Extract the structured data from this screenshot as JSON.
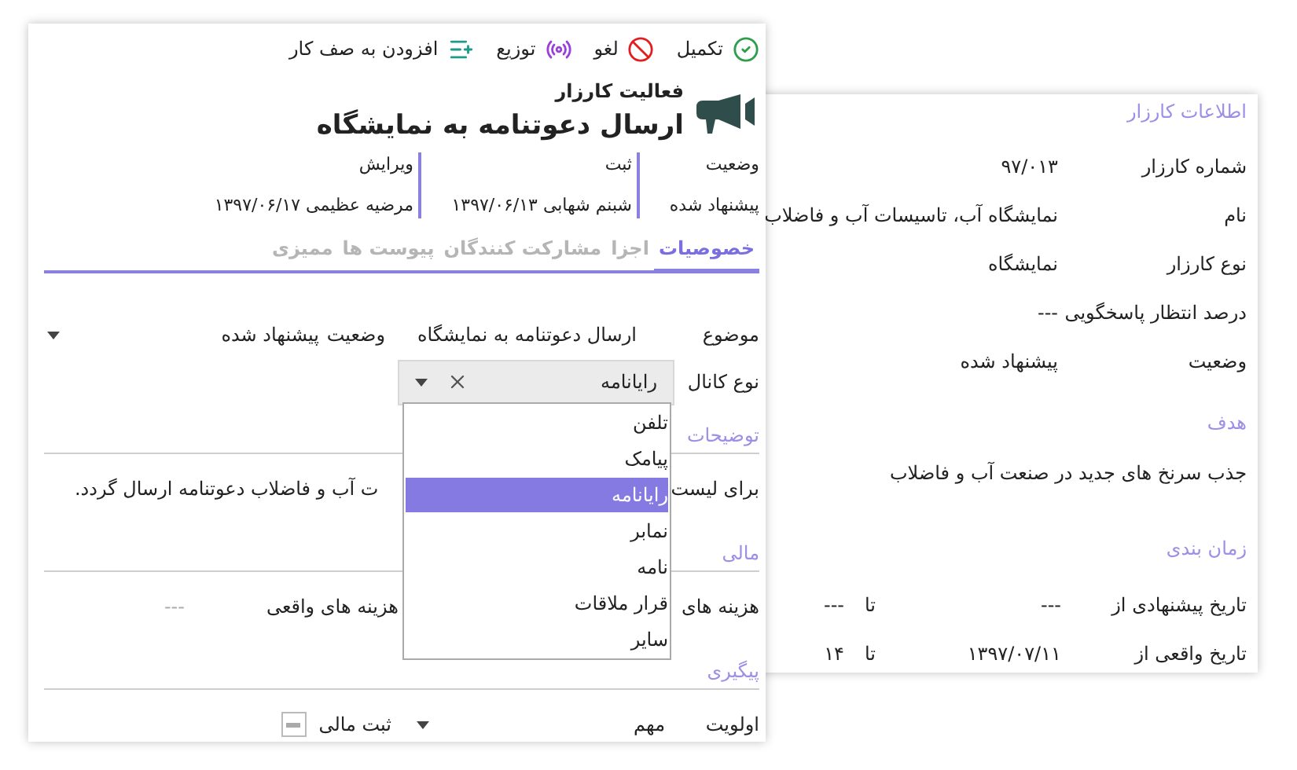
{
  "toolbar": [
    {
      "kind": "complete",
      "label": "تکمیل"
    },
    {
      "kind": "cancel",
      "label": "لغو"
    },
    {
      "kind": "distribute",
      "label": "توزیع"
    },
    {
      "kind": "queue",
      "label": "افزودن به صف کار"
    }
  ],
  "header": {
    "subtitle": "فعالیت کارزار",
    "title": "ارسال دعوتنامه به نمایشگاه"
  },
  "info": [
    {
      "label": "وضعیت",
      "value": "پیشنهاد شده"
    },
    {
      "label": "ثبت",
      "value": "شبنم شهابی ۱۳۹۷/۰۶/۱۳"
    },
    {
      "label": "ویرایش",
      "value": "مرضیه عظیمی ۱۳۹۷/۰۶/۱۷"
    }
  ],
  "tabs": [
    {
      "label": "خصوصیات",
      "selected": true
    },
    {
      "label": "اجزا",
      "selected": false
    },
    {
      "label": "مشارکت کنندگان",
      "selected": false
    },
    {
      "label": "پیوست ها",
      "selected": false
    },
    {
      "label": "ممیزی",
      "selected": false
    }
  ],
  "details": {
    "subject_label": "موضوع",
    "subject": "ارسال دعوتنامه به نمایشگاه",
    "status_label": "وضعیت",
    "status": "پیشنهاد شده",
    "channel_label": "نوع کانال",
    "channel": "رایانامه"
  },
  "channel_menu": [
    {
      "label": "تلفن",
      "selected": false
    },
    {
      "label": "پیامک",
      "selected": false
    },
    {
      "label": "رایانامه",
      "selected": true
    },
    {
      "label": "نمابر",
      "selected": false
    },
    {
      "label": "نامه",
      "selected": false
    },
    {
      "label": "قرار ملاقات",
      "selected": false
    },
    {
      "label": "سایر",
      "selected": false
    }
  ],
  "description": {
    "heading": "توضیحات",
    "text_start": "برای لیست",
    "text_end": "ت آب و فاضلاب دعوتنامه ارسال گردد."
  },
  "finance": {
    "heading": "مالی",
    "estimated_label": "هزینه های",
    "actual_label": "هزینه های واقعی",
    "actual": "---"
  },
  "follow_up": {
    "heading": "پیگیری",
    "priority_label": "اولویت",
    "priority": "مهم",
    "financial_label": "ثبت مالی",
    "financial_indeterminate": true
  },
  "campaign": {
    "heading": "اطلاعات کارزار",
    "fields": [
      {
        "label": "شماره کارزار",
        "value": "۹۷/۰۱۳"
      },
      {
        "label": "نام",
        "value": "نمایشگاه آب، تاسیسات آب و فاضلاب"
      },
      {
        "label": "نوع کارزار",
        "value": "نمایشگاه"
      },
      {
        "label": "درصد انتظار پاسخگویی",
        "value": "---"
      },
      {
        "label": "وضعیت",
        "value": "پیشنهاد شده"
      }
    ],
    "goal_heading": "هدف",
    "goal": "جذب سرنخ های جدید در صنعت آب و فاضلاب",
    "schedule_heading": "زمان بندی",
    "schedule": [
      {
        "label": "تاریخ پیشنهادی از",
        "from": "---",
        "to_label": "تا",
        "to": "---"
      },
      {
        "label": "تاریخ واقعی از",
        "from": "۱۳۹۷/۰۷/۱۱",
        "to_label": "تا",
        "to": "۱۴"
      }
    ]
  }
}
